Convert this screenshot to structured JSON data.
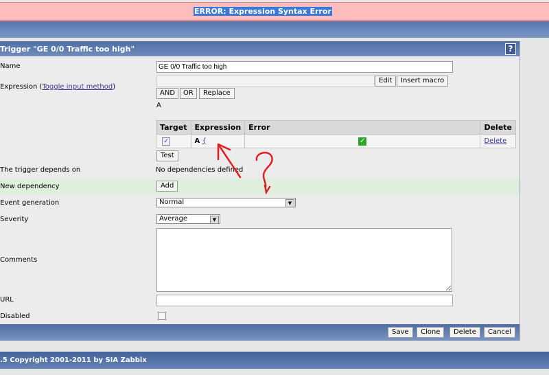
{
  "error": {
    "message": "ERROR: Expression Syntax Error"
  },
  "panel": {
    "title": "Trigger \"GE 0/0 Traffic too high\"",
    "help_icon": "?"
  },
  "form": {
    "name_label": "Name",
    "name_value": "GE 0/0 Traffic too high",
    "expression_label": "Expression (",
    "toggle_link": "Toggle input method",
    "expression_label_end": ")",
    "expression_value": "",
    "edit_button": "Edit",
    "insert_macro_button": "Insert macro",
    "and_button": "AND",
    "or_button": "OR",
    "replace_button": "Replace",
    "expression_text": "A",
    "table": {
      "headers": [
        "Target",
        "Expression",
        "Error",
        "Delete"
      ],
      "rows": [
        {
          "target_checked": true,
          "label": "A",
          "expr_link": "{",
          "error_ok": true,
          "delete_link": "Delete"
        }
      ]
    },
    "test_button": "Test",
    "depends_label": "The trigger depends on",
    "depends_value": "No dependencies defined",
    "new_dependency_label": "New dependency",
    "add_button": "Add",
    "event_generation_label": "Event generation",
    "event_generation_value": "Normal",
    "severity_label": "Severity",
    "severity_value": "Average",
    "comments_label": "Comments",
    "comments_value": "",
    "url_label": "URL",
    "url_value": "",
    "disabled_label": "Disabled",
    "disabled_checked": false
  },
  "footer_buttons": {
    "save": "Save",
    "clone": "Clone",
    "delete": "Delete",
    "cancel": "Cancel"
  },
  "copyright": ".5 Copyright 2001-2011 by SIA Zabbix",
  "annotation": {
    "color": "#e02020"
  }
}
